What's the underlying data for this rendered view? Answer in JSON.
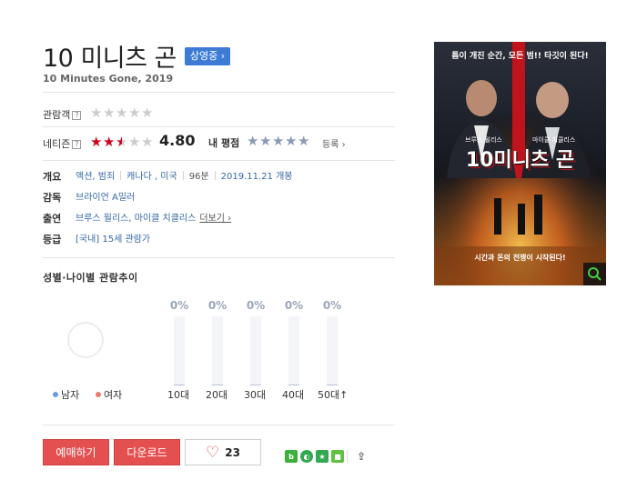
{
  "movie": {
    "title": "10 미니츠 곤",
    "status_badge": "상영중 ›",
    "subtitle": "10 Minutes Gone, 2019"
  },
  "ratings": {
    "audience_label": "관람객",
    "audience_stars": 0,
    "netizen_label": "네티즌",
    "netizen_stars": 2.4,
    "netizen_score": "4.80",
    "my_label": "내 평점",
    "my_stars": 0,
    "register_label": "등록 ›",
    "question_icon": "?"
  },
  "info": {
    "overview_label": "개요",
    "genres": "액션, 범죄",
    "countries": "캐나다 , 미국",
    "runtime": "96분",
    "release": "2019.11.21 개봉",
    "director_label": "감독",
    "director": "브라이언 A밀러",
    "cast_label": "출연",
    "cast": "브루스 윌리스, 마이클 치클리스",
    "more_label": "더보기 ›",
    "grade_label": "등급",
    "grade": "[국내] 15세 관람가"
  },
  "trend": {
    "title": "성별·나이별 관람추이",
    "legend": [
      {
        "label": "남자",
        "color": "#6a9be3"
      },
      {
        "label": "여자",
        "color": "#e77b6f"
      }
    ],
    "bars": [
      {
        "label": "10대",
        "pct_text": "0%",
        "value": 0
      },
      {
        "label": "20대",
        "pct_text": "0%",
        "value": 0
      },
      {
        "label": "30대",
        "pct_text": "0%",
        "value": 0
      },
      {
        "label": "40대",
        "pct_text": "0%",
        "value": 0
      },
      {
        "label": "50대↑",
        "pct_text": "0%",
        "value": 0
      }
    ]
  },
  "actions": {
    "reserve": "예매하기",
    "download": "다운로드",
    "like_count": "23"
  },
  "share": {
    "icons": [
      "blog-icon",
      "cafe-icon",
      "star-icon",
      "me2-icon",
      "share-icon"
    ]
  },
  "poster": {
    "tagline": "틈이 개진 순간, 모든 범!! 타깃이 된다!",
    "actor_left": "브루스 윌리스",
    "actor_right": "마이클 치클리스",
    "title": "10미니츠 곤",
    "bottom_text": "시간과 돈의 전쟁이 시작된다!"
  }
}
